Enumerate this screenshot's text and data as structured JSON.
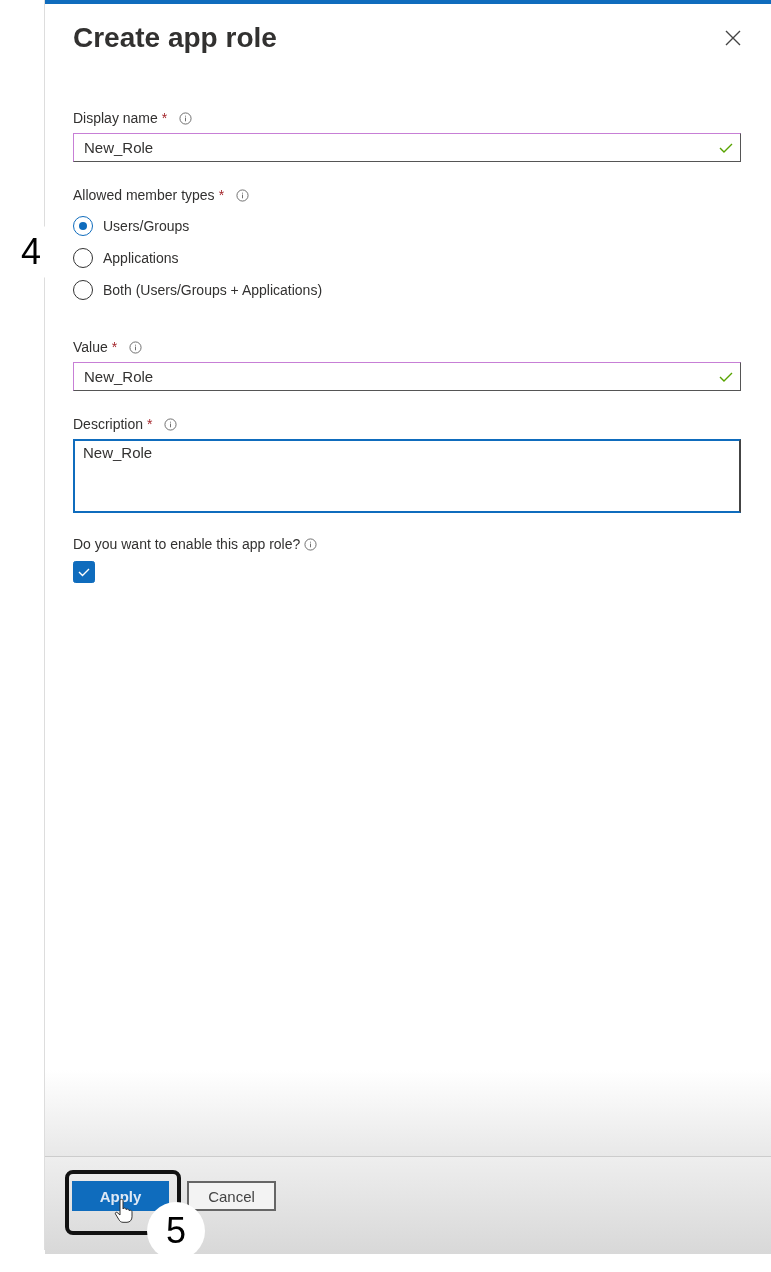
{
  "dialog": {
    "title": "Create app role"
  },
  "display_name": {
    "label": "Display name",
    "required_mark": "*",
    "value": "New_Role",
    "valid": true
  },
  "member_types": {
    "label": "Allowed member types",
    "required_mark": "*",
    "options": [
      {
        "label": "Users/Groups",
        "selected": true
      },
      {
        "label": "Applications",
        "selected": false
      },
      {
        "label": "Both (Users/Groups + Applications)",
        "selected": false
      }
    ]
  },
  "value": {
    "label": "Value",
    "required_mark": "*",
    "value": "New_Role",
    "valid": true
  },
  "description": {
    "label": "Description",
    "required_mark": "*",
    "value": "New_Role"
  },
  "enable": {
    "label": "Do you want to enable this app role?",
    "checked": true
  },
  "buttons": [
    {
      "label": "Apply",
      "kind": "primary"
    },
    {
      "label": "Cancel",
      "kind": "secondary"
    }
  ],
  "step_badges": [
    "4",
    "5"
  ]
}
